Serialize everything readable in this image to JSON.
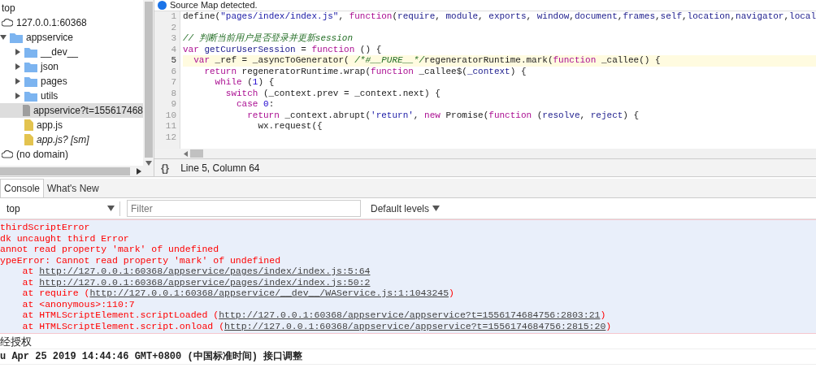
{
  "sources_tree": [
    {
      "kind": "frame",
      "label": "top",
      "selected": false
    },
    {
      "kind": "domain",
      "label": "127.0.0.1:60368",
      "selected": false,
      "children": [
        {
          "kind": "folder",
          "label": "appservice",
          "expanded": true,
          "selected": false,
          "children": [
            {
              "kind": "folder",
              "label": "__dev__",
              "expanded": false,
              "selected": false
            },
            {
              "kind": "folder",
              "label": "json",
              "expanded": false,
              "selected": false
            },
            {
              "kind": "folder",
              "label": "pages",
              "expanded": false,
              "selected": false
            },
            {
              "kind": "folder",
              "label": "utils",
              "expanded": false,
              "selected": false
            },
            {
              "kind": "file",
              "label": "appservice?t=155617468",
              "selected": true,
              "color": "#9e9e9e",
              "source_mapped": false
            },
            {
              "kind": "file",
              "label": "app.js",
              "selected": false,
              "color": "#e3c34f",
              "source_mapped": false
            },
            {
              "kind": "file",
              "label": "app.js? [sm]",
              "selected": false,
              "color": "#e3c34f",
              "source_mapped": true
            }
          ]
        }
      ]
    },
    {
      "kind": "domain",
      "label": "(no domain)",
      "selected": false
    }
  ],
  "editor": {
    "info_bar": "Source Map detected.",
    "lines": [
      {
        "number": "1",
        "current": false,
        "segments": [
          {
            "kind": "plain",
            "t": "define("
          },
          {
            "kind": "string",
            "t": "\"pages/index/index.js\""
          },
          {
            "kind": "plain",
            "t": ", "
          },
          {
            "kind": "keyword",
            "t": "function"
          },
          {
            "kind": "plain",
            "t": "("
          },
          {
            "kind": "param",
            "t": "require"
          },
          {
            "kind": "plain",
            "t": ", "
          },
          {
            "kind": "param",
            "t": "module"
          },
          {
            "kind": "plain",
            "t": ", "
          },
          {
            "kind": "param",
            "t": "exports"
          },
          {
            "kind": "plain",
            "t": ", "
          },
          {
            "kind": "param",
            "t": "window"
          },
          {
            "kind": "plain",
            "t": ","
          },
          {
            "kind": "param",
            "t": "document"
          },
          {
            "kind": "plain",
            "t": ","
          },
          {
            "kind": "param",
            "t": "frames"
          },
          {
            "kind": "plain",
            "t": ","
          },
          {
            "kind": "param",
            "t": "self"
          },
          {
            "kind": "plain",
            "t": ","
          },
          {
            "kind": "param",
            "t": "location"
          },
          {
            "kind": "plain",
            "t": ","
          },
          {
            "kind": "param",
            "t": "navigator"
          },
          {
            "kind": "plain",
            "t": ","
          },
          {
            "kind": "param",
            "t": "local"
          }
        ]
      },
      {
        "number": "2",
        "current": false
      },
      {
        "number": "3",
        "current": false,
        "segments": [
          {
            "kind": "comment",
            "t": "// 判断当前用户是否登录并更新session"
          }
        ]
      },
      {
        "number": "4",
        "current": false,
        "segments": [
          {
            "kind": "keyword",
            "t": "var "
          },
          {
            "kind": "param",
            "t": "getCurUserSession"
          },
          {
            "kind": "plain",
            "t": " = "
          },
          {
            "kind": "keyword",
            "t": "function"
          },
          {
            "kind": "plain",
            "t": " () {"
          }
        ]
      },
      {
        "number": "5",
        "current": true,
        "segments": [
          {
            "kind": "keyword",
            "t": "  var"
          },
          {
            "kind": "plain",
            "t": " _ref = _asyncToGenerator( "
          },
          {
            "kind": "comment",
            "t": "/*#__PURE__*/"
          },
          {
            "kind": "plain",
            "t": "regeneratorRuntime.mark("
          },
          {
            "kind": "keyword",
            "t": "function"
          },
          {
            "kind": "plain",
            "t": " _callee() {"
          }
        ]
      },
      {
        "number": "6",
        "current": false,
        "segments": [
          {
            "kind": "keyword",
            "t": "    return"
          },
          {
            "kind": "plain",
            "t": " regeneratorRuntime.wrap("
          },
          {
            "kind": "keyword",
            "t": "function"
          },
          {
            "kind": "plain",
            "t": " _callee$("
          },
          {
            "kind": "param",
            "t": "_context"
          },
          {
            "kind": "plain",
            "t": ") {"
          }
        ]
      },
      {
        "number": "7",
        "current": false,
        "segments": [
          {
            "kind": "keyword",
            "t": "      while"
          },
          {
            "kind": "plain",
            "t": " ("
          },
          {
            "kind": "number",
            "t": "1"
          },
          {
            "kind": "plain",
            "t": ") {"
          }
        ]
      },
      {
        "number": "8",
        "current": false,
        "segments": [
          {
            "kind": "keyword",
            "t": "        switch"
          },
          {
            "kind": "plain",
            "t": " (_context.prev = _context.next) {"
          }
        ]
      },
      {
        "number": "9",
        "current": false,
        "segments": [
          {
            "kind": "keyword",
            "t": "          case "
          },
          {
            "kind": "number",
            "t": "0"
          },
          {
            "kind": "plain",
            "t": ":"
          }
        ]
      },
      {
        "number": "10",
        "current": false,
        "segments": [
          {
            "kind": "keyword",
            "t": "            return"
          },
          {
            "kind": "plain",
            "t": " _context.abrupt("
          },
          {
            "kind": "string",
            "t": "'return'"
          },
          {
            "kind": "plain",
            "t": ", "
          },
          {
            "kind": "keyword",
            "t": "new"
          },
          {
            "kind": "plain",
            "t": " Promise("
          },
          {
            "kind": "keyword",
            "t": "function"
          },
          {
            "kind": "plain",
            "t": " ("
          },
          {
            "kind": "param",
            "t": "resolve"
          },
          {
            "kind": "plain",
            "t": ", "
          },
          {
            "kind": "param",
            "t": "reject"
          },
          {
            "kind": "plain",
            "t": ") {"
          }
        ]
      },
      {
        "number": "11",
        "current": false,
        "segments": [
          {
            "kind": "plain",
            "t": "              wx.request({"
          }
        ]
      },
      {
        "number": "12",
        "current": false
      }
    ],
    "format_button": "{}",
    "status": "Line 5, Column 64"
  },
  "console": {
    "tabs": [
      {
        "label": "Console",
        "selected": true
      },
      {
        "label": "What's New",
        "selected": false
      }
    ],
    "context": "top",
    "filter": {
      "placeholder": "Filter"
    },
    "levels": "Default levels",
    "error": {
      "lines": [
        [
          {
            "kind": "text",
            "t": "thirdScriptError"
          }
        ],
        [
          {
            "kind": "text",
            "t": "dk uncaught third Error"
          }
        ],
        [
          {
            "kind": "text",
            "t": "annot read property 'mark' of undefined"
          }
        ],
        [
          {
            "kind": "text",
            "t": "ypeError: Cannot read property 'mark' of undefined"
          }
        ],
        [
          {
            "kind": "text",
            "t": "    at "
          },
          {
            "kind": "link",
            "t": "http://127.0.0.1:60368/appservice/pages/index/index.js:5:64"
          }
        ],
        [
          {
            "kind": "text",
            "t": "    at "
          },
          {
            "kind": "link",
            "t": "http://127.0.0.1:60368/appservice/pages/index/index.js:50:2"
          }
        ],
        [
          {
            "kind": "text",
            "t": "    at require ("
          },
          {
            "kind": "link",
            "t": "http://127.0.0.1:60368/appservice/__dev__/WAService.js:1:1043245"
          },
          {
            "kind": "text",
            "t": ")"
          }
        ],
        [
          {
            "kind": "text",
            "t": "    at <anonymous>:110:7"
          }
        ],
        [
          {
            "kind": "text",
            "t": "    at HTMLScriptElement.scriptLoaded ("
          },
          {
            "kind": "link",
            "t": "http://127.0.0.1:60368/appservice/appservice?t=1556174684756:2803:21"
          },
          {
            "kind": "text",
            "t": ")"
          }
        ],
        [
          {
            "kind": "text",
            "t": "    at HTMLScriptElement.script.onload ("
          },
          {
            "kind": "link",
            "t": "http://127.0.0.1:60368/appservice/appservice?t=1556174684756:2815:20"
          },
          {
            "kind": "text",
            "t": ")"
          }
        ]
      ]
    },
    "logs": [
      "经授权",
      "u Apr 25 2019 14:44:46 GMT+0800 (中国标准时间) 接口调整"
    ]
  }
}
